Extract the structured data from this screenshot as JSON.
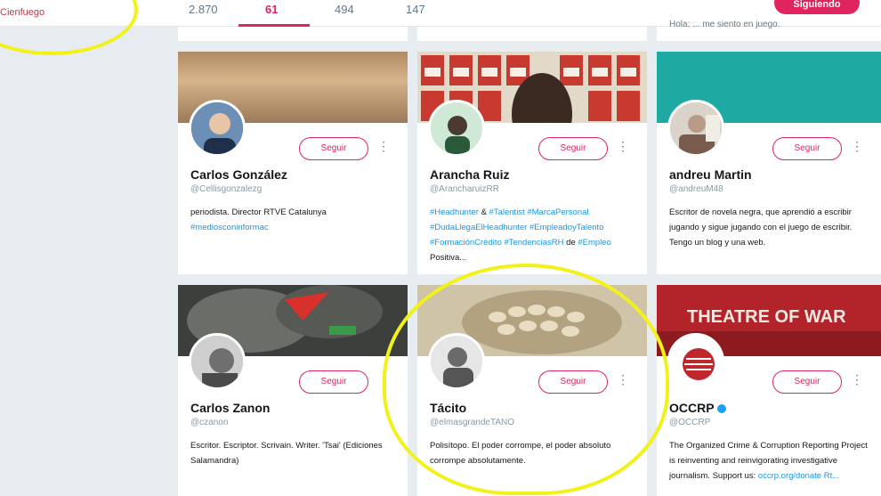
{
  "profile": {
    "name": "",
    "handle": "Cienfuego"
  },
  "stats": [
    {
      "value": "2.870"
    },
    {
      "value": "61",
      "active": true
    },
    {
      "value": "494"
    },
    {
      "value": "147"
    }
  ],
  "header_button": "Siguiendo",
  "strip_text": "Hola; ... me siento en juego.",
  "cards": [
    {
      "name": "Carlos González",
      "handle": "@Cellisgonzalezg",
      "button": "Seguir",
      "bio_plain": "periodista. Director RTVE Catalunya",
      "bio_link": "#mediosconinformac"
    },
    {
      "name": "Arancha Ruiz",
      "handle": "@ArancharuizRR",
      "button": "Seguir",
      "bio_parts": [
        "#Headhunter",
        " & ",
        "#Talentist",
        " ",
        "#MarcaPersonal",
        " ",
        "#DudaLlegaElHeadhunter",
        " ",
        "#EmpleadoyTalento",
        " ",
        "#FormaciónCrédito",
        " ",
        "#TendenciasRH",
        " de ",
        "#Empleo",
        " Positiva..."
      ]
    },
    {
      "name": "andreu Martin",
      "handle": "@andreuM48",
      "button": "Seguir",
      "bio_plain": "Escritor de novela negra, que aprendió a escribir jugando y sigue jugando con el juego de escribir. Tengo un blog y una web."
    },
    {
      "name": "Carlos Zanon",
      "handle": "@czanon",
      "button": "Seguir",
      "bio_plain": "Escritor. Escriptor. Scrivain. Writer. 'Tsai' (Ediciones Salamandra)"
    },
    {
      "name": "Tácito",
      "handle": "@elmasgrandeTANO",
      "button": "Seguir",
      "bio_plain": "Polisítopo. El poder corrompe, el poder absoluto corrompe absolutamente."
    },
    {
      "name": "OCCRP",
      "handle": "@OCCRP",
      "button": "Seguir",
      "verified": true,
      "bio_plain": "The Organized Crime & Corruption Reporting Project is reinventing and reinvigorating investigative journalism. Support us: ",
      "bio_link": "occrp.org/donate Rt..."
    }
  ],
  "banner_text_occrp": "THEATRE OF WAR",
  "colors": {
    "accent": "#e0245e",
    "link": "#1b95e0",
    "highlight": "#f2f21a"
  }
}
